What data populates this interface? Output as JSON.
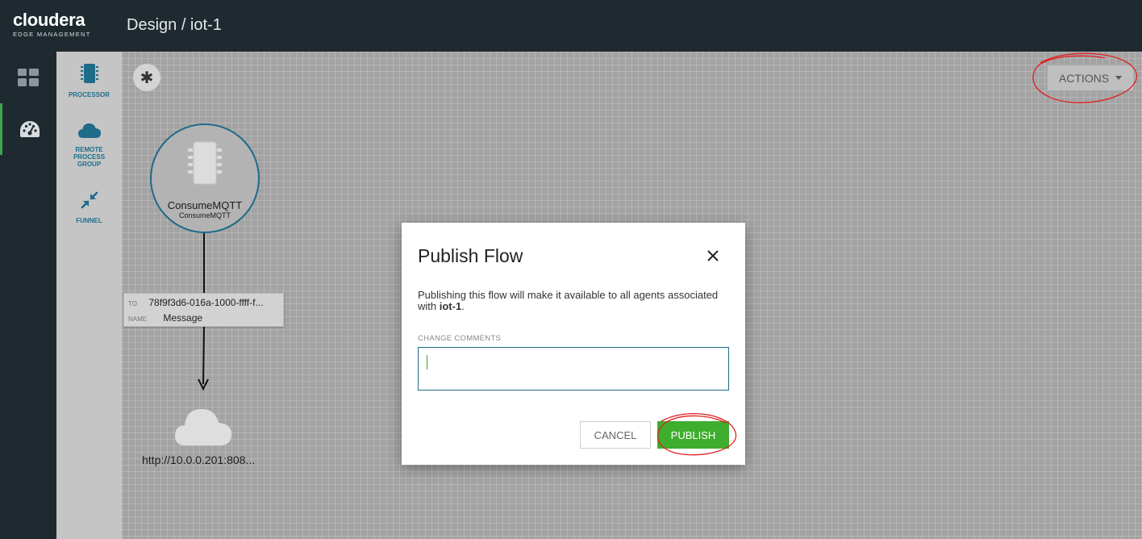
{
  "header": {
    "logo_main": "cloudera",
    "logo_sub": "EDGE MANAGEMENT",
    "title": "Design / iot-1"
  },
  "leftnav": {
    "items": [
      {
        "icon": "dashboard-grid-icon",
        "active": false
      },
      {
        "icon": "gauge-icon",
        "active": true
      }
    ]
  },
  "palette": {
    "items": [
      {
        "label": "PROCESSOR",
        "icon": "chip-icon"
      },
      {
        "label": "REMOTE PROCESS GROUP",
        "label_lines": [
          "REMOTE",
          "PROCESS",
          "GROUP"
        ],
        "icon": "cloud-icon"
      },
      {
        "label": "FUNNEL",
        "icon": "funnel-arrows-icon"
      }
    ]
  },
  "canvas": {
    "toolbar_icon": "asterisk-icon",
    "actions_label": "ACTIONS",
    "processor": {
      "name": "ConsumeMQTT",
      "type": "ConsumeMQTT"
    },
    "connection": {
      "to_key": "TO",
      "to_value": "78f9f3d6-016a-1000-ffff-f...",
      "name_key": "NAME",
      "name_value": "Message"
    },
    "remote_group": {
      "url": "http://10.0.0.201:808..."
    }
  },
  "modal": {
    "title": "Publish Flow",
    "desc_prefix": "Publishing this flow will make it available to all agents associated with ",
    "desc_flow": "iot-1",
    "desc_suffix": ".",
    "comments_label": "CHANGE COMMENTS",
    "comments_value": "",
    "cancel_label": "CANCEL",
    "publish_label": "PUBLISH"
  },
  "colors": {
    "header_bg": "#1f2a30",
    "accent_blue": "#1e6b8a",
    "publish_green": "#3fad2e",
    "annotation_red": "#e02020"
  }
}
